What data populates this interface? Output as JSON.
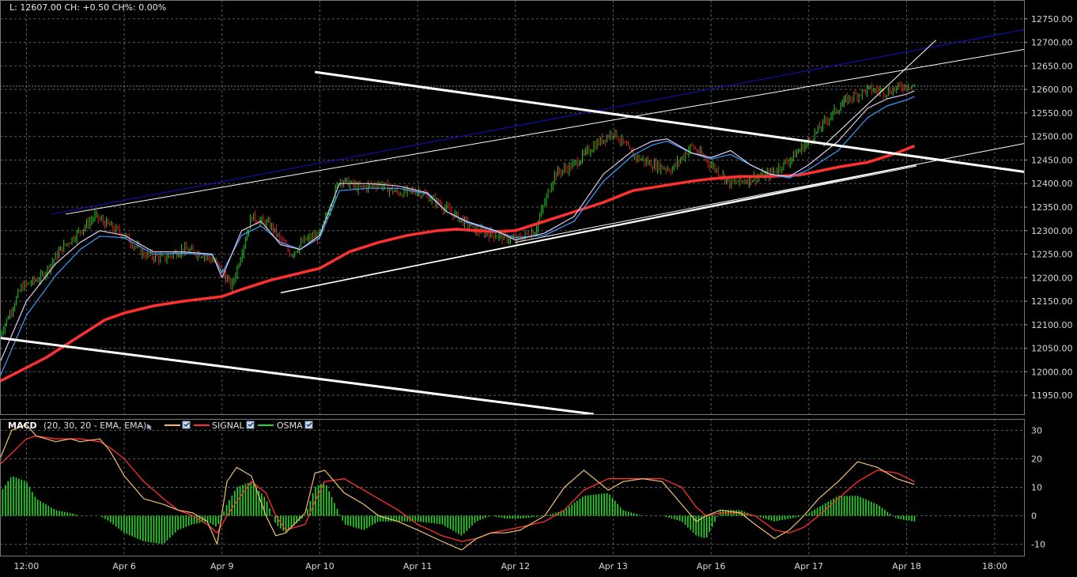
{
  "header": {
    "ohlc_readout": "L: 12607.00 CH: +0.50 CH%: 0.00%"
  },
  "macd_legend": {
    "name": "MACD",
    "params": "(20, 30, 20 - EMA, EMA)",
    "series": [
      {
        "label": "",
        "color": "#f0c070"
      },
      {
        "label": "SIGNAL",
        "color": "#ff3030"
      },
      {
        "label": "OSMA",
        "color": "#22dd22"
      }
    ]
  },
  "colors": {
    "background": "#000000",
    "grid": "#5a5a5a",
    "price_bar_up": "#22cc22",
    "price_bar_down": "#dd2222",
    "ema_fast": "#e0c8f0",
    "ema_mid": "#3aa0ff",
    "ma_long": "#ff3030",
    "trendline_white": "#ffffff",
    "trendline_blue": "#1010cc"
  },
  "chart_data": [
    {
      "type": "line",
      "panel": "price",
      "x_axis": {
        "labels": [
          "12:00",
          "Apr 6",
          "Apr 9",
          "Apr 10",
          "Apr 11",
          "Apr 12",
          "Apr 13",
          "Apr 16",
          "Apr 17",
          "Apr 18",
          "18:00"
        ],
        "positions": [
          0,
          1,
          2,
          3,
          4,
          5,
          6,
          7,
          8,
          9,
          9.9
        ],
        "xlim": [
          -0.27,
          10.2
        ]
      },
      "y_axis": {
        "ticks": [
          11950,
          12000,
          12050,
          12100,
          12150,
          12200,
          12250,
          12300,
          12350,
          12400,
          12450,
          12500,
          12550,
          12600,
          12650,
          12700,
          12750
        ],
        "ylim": [
          11910,
          12790
        ]
      },
      "current_price": 12607,
      "series": [
        {
          "key": "close",
          "style": "bars",
          "x": [
            -0.27,
            -0.05,
            0.15,
            0.35,
            0.55,
            0.7,
            0.85,
            1.0,
            1.2,
            1.4,
            1.6,
            1.8,
            1.95,
            2.1,
            2.3,
            2.5,
            2.7,
            2.85,
            3.0,
            3.2,
            3.4,
            3.6,
            3.8,
            4.0,
            4.2,
            4.4,
            4.6,
            4.8,
            5.0,
            5.2,
            5.4,
            5.6,
            5.8,
            6.0,
            6.2,
            6.4,
            6.6,
            6.8,
            7.0,
            7.2,
            7.4,
            7.6,
            7.8,
            8.0,
            8.2,
            8.4,
            8.6,
            8.8,
            9.0,
            9.08
          ],
          "y": [
            12080,
            12180,
            12200,
            12260,
            12300,
            12330,
            12310,
            12290,
            12250,
            12240,
            12260,
            12250,
            12230,
            12180,
            12330,
            12310,
            12250,
            12280,
            12290,
            12410,
            12390,
            12400,
            12380,
            12385,
            12360,
            12330,
            12300,
            12290,
            12280,
            12300,
            12420,
            12440,
            12480,
            12510,
            12460,
            12440,
            12430,
            12480,
            12440,
            12400,
            12410,
            12420,
            12450,
            12490,
            12540,
            12580,
            12600,
            12595,
            12610,
            12607
          ]
        },
        {
          "key": "ema_fast",
          "style": "line",
          "x": [
            -0.27,
            0.0,
            0.3,
            0.55,
            0.75,
            1.0,
            1.3,
            1.6,
            1.9,
            2.0,
            2.2,
            2.4,
            2.6,
            2.8,
            3.0,
            3.2,
            3.5,
            3.8,
            4.1,
            4.3,
            4.5,
            4.8,
            5.0,
            5.3,
            5.6,
            5.9,
            6.2,
            6.4,
            6.55,
            6.8,
            7.0,
            7.2,
            7.4,
            7.6,
            7.8,
            8.0,
            8.3,
            8.6,
            8.8,
            9.0,
            9.08
          ],
          "y": [
            12020,
            12150,
            12230,
            12275,
            12300,
            12290,
            12255,
            12255,
            12250,
            12200,
            12300,
            12320,
            12270,
            12260,
            12290,
            12400,
            12400,
            12395,
            12380,
            12340,
            12320,
            12300,
            12280,
            12295,
            12330,
            12420,
            12470,
            12490,
            12495,
            12465,
            12455,
            12470,
            12440,
            12420,
            12415,
            12440,
            12490,
            12560,
            12580,
            12590,
            12597
          ]
        },
        {
          "key": "ema_mid",
          "style": "line",
          "x": [
            -0.27,
            0.0,
            0.3,
            0.55,
            0.75,
            1.0,
            1.3,
            1.6,
            1.9,
            2.0,
            2.2,
            2.4,
            2.6,
            2.8,
            3.0,
            3.2,
            3.5,
            3.8,
            4.1,
            4.3,
            4.5,
            4.8,
            5.0,
            5.3,
            5.6,
            5.9,
            6.2,
            6.4,
            6.55,
            6.8,
            7.0,
            7.2,
            7.4,
            7.6,
            7.8,
            8.0,
            8.3,
            8.6,
            8.8,
            9.0,
            9.08
          ],
          "y": [
            11990,
            12120,
            12205,
            12260,
            12288,
            12285,
            12250,
            12252,
            12248,
            12210,
            12290,
            12310,
            12275,
            12260,
            12285,
            12385,
            12390,
            12390,
            12378,
            12340,
            12318,
            12298,
            12285,
            12290,
            12320,
            12405,
            12460,
            12482,
            12490,
            12465,
            12452,
            12462,
            12440,
            12420,
            12412,
            12430,
            12470,
            12540,
            12565,
            12578,
            12585
          ]
        },
        {
          "key": "ma_long",
          "style": "line",
          "x": [
            -0.27,
            0.2,
            0.5,
            0.8,
            1.0,
            1.3,
            1.6,
            2.0,
            2.2,
            2.5,
            2.8,
            3.0,
            3.3,
            3.6,
            3.9,
            4.2,
            4.4,
            4.6,
            4.8,
            5.0,
            5.3,
            5.6,
            5.9,
            6.2,
            6.5,
            6.8,
            7.0,
            7.3,
            7.6,
            7.9,
            8.0,
            8.3,
            8.6,
            8.9,
            9.08
          ],
          "y": [
            11980,
            12030,
            12070,
            12110,
            12125,
            12140,
            12150,
            12160,
            12175,
            12195,
            12210,
            12220,
            12255,
            12275,
            12290,
            12300,
            12303,
            12300,
            12298,
            12300,
            12320,
            12340,
            12360,
            12385,
            12395,
            12405,
            12410,
            12415,
            12415,
            12418,
            12422,
            12435,
            12445,
            12465,
            12480
          ]
        }
      ],
      "trendlines": [
        {
          "color": "white",
          "from": [
            -0.27,
            12072
          ],
          "to": [
            5.8,
            11910
          ]
        },
        {
          "color": "white",
          "from": [
            2.6,
            12168
          ],
          "to": [
            9.1,
            12440
          ]
        },
        {
          "color": "white",
          "from": [
            2.6,
            12168
          ],
          "to": [
            9.1,
            12437
          ]
        },
        {
          "color": "white",
          "from": [
            5.0,
            12275
          ],
          "to": [
            10.2,
            12485
          ]
        },
        {
          "color": "white",
          "from": [
            0.4,
            12335
          ],
          "to": [
            10.2,
            12685
          ]
        },
        {
          "color": "blue",
          "from": [
            0.25,
            12335
          ],
          "to": [
            10.2,
            12727
          ]
        },
        {
          "color": "white",
          "from": [
            2.95,
            12637
          ],
          "to": [
            10.2,
            12425
          ]
        },
        {
          "color": "white",
          "from": [
            8.15,
            12480
          ],
          "to": [
            9.3,
            12705
          ]
        }
      ]
    },
    {
      "type": "line",
      "panel": "macd",
      "y_axis": {
        "ticks": [
          -10,
          0,
          10,
          20,
          30
        ],
        "ylim": [
          -14,
          34
        ]
      },
      "x": [
        -0.27,
        -0.15,
        0.0,
        0.1,
        0.3,
        0.45,
        0.55,
        0.75,
        0.85,
        1.0,
        1.2,
        1.4,
        1.55,
        1.7,
        1.85,
        1.95,
        2.05,
        2.15,
        2.3,
        2.45,
        2.55,
        2.65,
        2.85,
        2.95,
        3.05,
        3.25,
        3.45,
        3.6,
        3.8,
        4.0,
        4.25,
        4.45,
        4.6,
        4.75,
        4.9,
        5.05,
        5.3,
        5.5,
        5.7,
        5.95,
        6.1,
        6.3,
        6.5,
        6.7,
        6.85,
        6.95,
        7.1,
        7.3,
        7.45,
        7.65,
        7.8,
        7.95,
        8.1,
        8.3,
        8.5,
        8.7,
        8.9,
        9.08
      ],
      "series": [
        {
          "key": "macd",
          "values": [
            20,
            30,
            32,
            28,
            26,
            27,
            26,
            27,
            23,
            14,
            6,
            4,
            2,
            1,
            -2,
            -10,
            12,
            17,
            14,
            0,
            -7,
            -6,
            1,
            15,
            16,
            8,
            4,
            0,
            -2,
            -5,
            -9,
            -12,
            -8,
            -6,
            -6,
            -5,
            0,
            10,
            16,
            9,
            12,
            13,
            12,
            4,
            -2,
            0,
            2,
            1,
            -3,
            -8,
            -5,
            0,
            6,
            12,
            19,
            17,
            13,
            11
          ]
        },
        {
          "key": "signal",
          "values": [
            18,
            22,
            27,
            28,
            27,
            27,
            27,
            26,
            24,
            20,
            12,
            6,
            2,
            0,
            -3,
            -6,
            0,
            5,
            12,
            8,
            0,
            -5,
            -3,
            5,
            12,
            13,
            9,
            6,
            2,
            -3,
            -7,
            -9,
            -8,
            -6,
            -5,
            -4,
            -2,
            2,
            9,
            13,
            13,
            13,
            13,
            10,
            3,
            0,
            1,
            1,
            0,
            -5,
            -6,
            -4,
            0,
            6,
            12,
            16,
            15,
            12
          ]
        },
        {
          "key": "osma",
          "values": [
            8,
            14,
            12,
            6,
            2,
            1,
            0,
            0,
            -2,
            -6,
            -9,
            -10,
            -5,
            -3,
            -2,
            -4,
            4,
            10,
            12,
            6,
            -3,
            -6,
            0,
            10,
            12,
            -3,
            -5,
            -2,
            -2,
            -2,
            -3,
            -7,
            -2,
            0,
            -1,
            -1,
            0,
            2,
            7,
            8,
            2,
            0,
            0,
            -2,
            -7,
            -8,
            2,
            2,
            0,
            -2,
            -1,
            0,
            3,
            7,
            7,
            4,
            -1,
            -2
          ]
        }
      ]
    }
  ]
}
